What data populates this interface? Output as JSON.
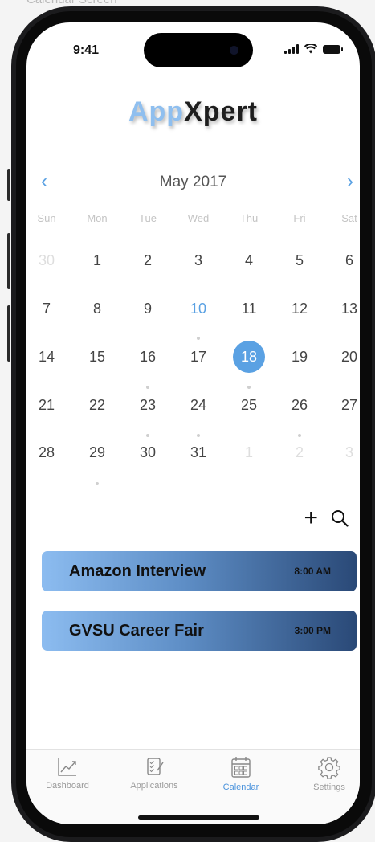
{
  "caption": "Calendar Screen",
  "status": {
    "time": "9:41"
  },
  "logo": {
    "part1": "App",
    "part2": "Xpert"
  },
  "calendar": {
    "month_title": "May 2017",
    "prev": "‹",
    "next": "›",
    "weekdays": [
      "Sun",
      "Mon",
      "Tue",
      "Wed",
      "Thu",
      "Fri",
      "Sat"
    ],
    "weeks": [
      [
        "30",
        "1",
        "2",
        "3",
        "4",
        "5",
        "6"
      ],
      [
        "7",
        "8",
        "9",
        "10",
        "11",
        "12",
        "13"
      ],
      [
        "14",
        "15",
        "16",
        "17",
        "18",
        "19",
        "20"
      ],
      [
        "21",
        "22",
        "23",
        "24",
        "25",
        "26",
        "27"
      ],
      [
        "28",
        "29",
        "30",
        "31",
        "1",
        "2",
        "3"
      ]
    ],
    "today": "10",
    "selected": "18",
    "accent": "#5aa1e3"
  },
  "events": [
    {
      "title": "Amazon Interview",
      "time": "8:00 AM"
    },
    {
      "title": "GVSU Career Fair",
      "time": "3:00 PM"
    }
  ],
  "tabs": [
    {
      "label": "Dashboard",
      "icon": "chart-line-icon"
    },
    {
      "label": "Applications",
      "icon": "checklist-icon"
    },
    {
      "label": "Calendar",
      "icon": "calendar-icon"
    },
    {
      "label": "Settings",
      "icon": "gear-icon"
    }
  ],
  "active_tab": "Calendar"
}
